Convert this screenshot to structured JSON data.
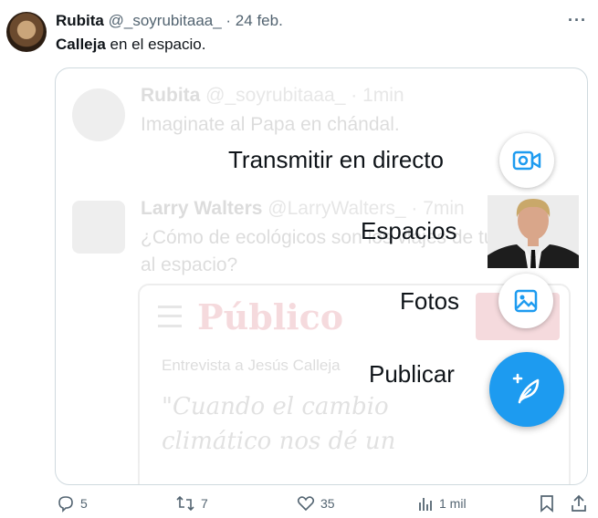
{
  "author": {
    "name": "Rubita",
    "handle": "@_soyrubitaaa_",
    "date": "· 24 feb."
  },
  "tweet": {
    "bold": "Calleja",
    "rest": " en el espacio."
  },
  "background": {
    "tweet1": {
      "name": "Rubita",
      "handle": "@_soyrubitaaa_",
      "time": "· 1min",
      "text": "Imaginate al Papa en chándal."
    },
    "tweet2": {
      "name": "Larry Walters",
      "handle": "@LarryWalters_",
      "time": "· 7min",
      "text1": "¿Cómo de ecológicos son los viajes de turistas",
      "text2": "al espacio?"
    },
    "card": {
      "brand": "Público",
      "subtitle": "Entrevista a Jesús Calleja",
      "quote1": "\"Cuando el cambio",
      "quote2": "climático nos dé un"
    }
  },
  "menu": {
    "live": "Transmitir en directo",
    "spaces": "Espacios",
    "photos": "Fotos",
    "post": "Publicar"
  },
  "actions": {
    "replies": "5",
    "reposts": "7",
    "likes": "35",
    "views": "1 mil"
  },
  "colors": {
    "accent": "#1d9bf0",
    "muted": "#536471",
    "text": "#0f1419"
  }
}
